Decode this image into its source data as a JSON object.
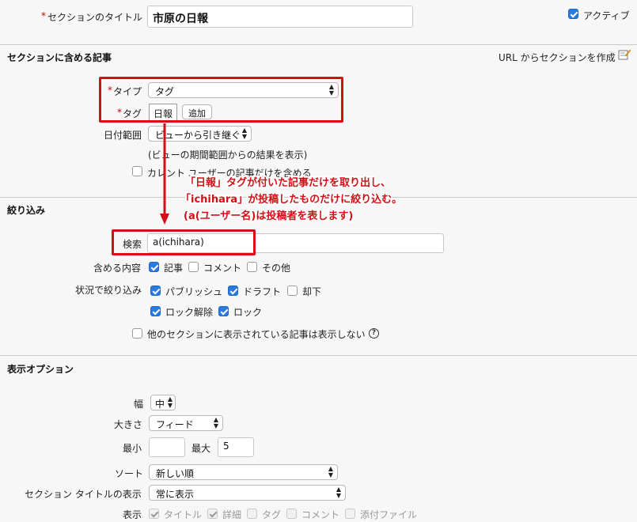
{
  "header": {
    "title_label": "セクションのタイトル",
    "title_value": "市原の日報",
    "active_label": "アクティブ",
    "active_checked": true
  },
  "articles_section": {
    "heading": "セクションに含める記事",
    "create_from_url": "URL からセクションを作成",
    "type_label": "タイプ",
    "type_value": "タグ",
    "tag_label": "タグ",
    "tag_value": "日報",
    "add_button": "追加",
    "date_range_label": "日付範囲",
    "date_range_value": "ビューから引き継ぐ",
    "date_range_hint": "(ビューの期間範囲からの結果を表示)",
    "current_user_only": "カレント ユーザーの記事だけを含める",
    "current_user_checked": false
  },
  "annotation": {
    "line1": "「日報」タグが付いた記事だけを取り出し、",
    "line2": "「ichihara」が投稿したものだけに絞り込む。",
    "line3": "(a(ユーザー名)は投稿者を表します)"
  },
  "filter_section": {
    "heading": "絞り込み",
    "search_label": "検索",
    "search_value": "a(ichihara)",
    "include_label": "含める内容",
    "include": [
      {
        "label": "記事",
        "checked": true
      },
      {
        "label": "コメント",
        "checked": false
      },
      {
        "label": "その他",
        "checked": false
      }
    ],
    "status_label": "状況で絞り込み",
    "status": [
      {
        "label": "パブリッシュ",
        "checked": true
      },
      {
        "label": "ドラフト",
        "checked": true
      },
      {
        "label": "却下",
        "checked": false
      },
      {
        "label": "ロック解除",
        "checked": true
      },
      {
        "label": "ロック",
        "checked": true
      }
    ],
    "hide_other_sections": "他のセクションに表示されている記事は表示しない",
    "hide_other_checked": false
  },
  "display_section": {
    "heading": "表示オプション",
    "width_label": "幅",
    "width_value": "中",
    "size_label": "大きさ",
    "size_value": "フィード",
    "min_label": "最小",
    "min_value": "",
    "max_label": "最大",
    "max_value": "5",
    "sort_label": "ソート",
    "sort_value": "新しい順",
    "title_display_label": "セクション タイトルの表示",
    "title_display_value": "常に表示",
    "show_label": "表示",
    "show": [
      {
        "label": "タイトル",
        "checked": true
      },
      {
        "label": "詳細",
        "checked": true
      },
      {
        "label": "タグ",
        "checked": false
      },
      {
        "label": "コメント",
        "checked": false
      },
      {
        "label": "添付ファイル",
        "checked": false
      }
    ]
  },
  "colors": {
    "annotation_red": "#d40f16",
    "checkbox_blue": "#2a7be0"
  }
}
